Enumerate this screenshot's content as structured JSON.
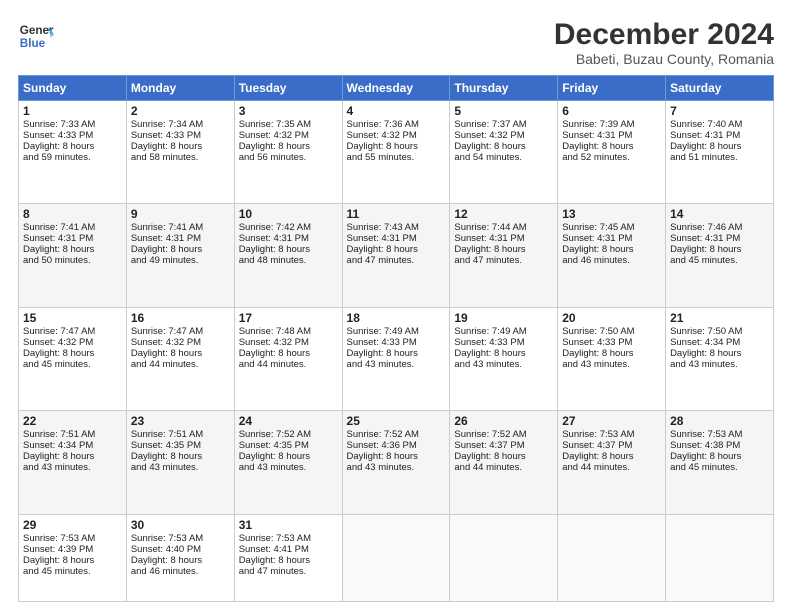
{
  "header": {
    "logo_line1": "General",
    "logo_line2": "Blue",
    "title": "December 2024",
    "subtitle": "Babeti, Buzau County, Romania"
  },
  "columns": [
    "Sunday",
    "Monday",
    "Tuesday",
    "Wednesday",
    "Thursday",
    "Friday",
    "Saturday"
  ],
  "weeks": [
    [
      {
        "day": "1",
        "lines": [
          "Sunrise: 7:33 AM",
          "Sunset: 4:33 PM",
          "Daylight: 8 hours",
          "and 59 minutes."
        ]
      },
      {
        "day": "2",
        "lines": [
          "Sunrise: 7:34 AM",
          "Sunset: 4:33 PM",
          "Daylight: 8 hours",
          "and 58 minutes."
        ]
      },
      {
        "day": "3",
        "lines": [
          "Sunrise: 7:35 AM",
          "Sunset: 4:32 PM",
          "Daylight: 8 hours",
          "and 56 minutes."
        ]
      },
      {
        "day": "4",
        "lines": [
          "Sunrise: 7:36 AM",
          "Sunset: 4:32 PM",
          "Daylight: 8 hours",
          "and 55 minutes."
        ]
      },
      {
        "day": "5",
        "lines": [
          "Sunrise: 7:37 AM",
          "Sunset: 4:32 PM",
          "Daylight: 8 hours",
          "and 54 minutes."
        ]
      },
      {
        "day": "6",
        "lines": [
          "Sunrise: 7:39 AM",
          "Sunset: 4:31 PM",
          "Daylight: 8 hours",
          "and 52 minutes."
        ]
      },
      {
        "day": "7",
        "lines": [
          "Sunrise: 7:40 AM",
          "Sunset: 4:31 PM",
          "Daylight: 8 hours",
          "and 51 minutes."
        ]
      }
    ],
    [
      {
        "day": "8",
        "lines": [
          "Sunrise: 7:41 AM",
          "Sunset: 4:31 PM",
          "Daylight: 8 hours",
          "and 50 minutes."
        ]
      },
      {
        "day": "9",
        "lines": [
          "Sunrise: 7:41 AM",
          "Sunset: 4:31 PM",
          "Daylight: 8 hours",
          "and 49 minutes."
        ]
      },
      {
        "day": "10",
        "lines": [
          "Sunrise: 7:42 AM",
          "Sunset: 4:31 PM",
          "Daylight: 8 hours",
          "and 48 minutes."
        ]
      },
      {
        "day": "11",
        "lines": [
          "Sunrise: 7:43 AM",
          "Sunset: 4:31 PM",
          "Daylight: 8 hours",
          "and 47 minutes."
        ]
      },
      {
        "day": "12",
        "lines": [
          "Sunrise: 7:44 AM",
          "Sunset: 4:31 PM",
          "Daylight: 8 hours",
          "and 47 minutes."
        ]
      },
      {
        "day": "13",
        "lines": [
          "Sunrise: 7:45 AM",
          "Sunset: 4:31 PM",
          "Daylight: 8 hours",
          "and 46 minutes."
        ]
      },
      {
        "day": "14",
        "lines": [
          "Sunrise: 7:46 AM",
          "Sunset: 4:31 PM",
          "Daylight: 8 hours",
          "and 45 minutes."
        ]
      }
    ],
    [
      {
        "day": "15",
        "lines": [
          "Sunrise: 7:47 AM",
          "Sunset: 4:32 PM",
          "Daylight: 8 hours",
          "and 45 minutes."
        ]
      },
      {
        "day": "16",
        "lines": [
          "Sunrise: 7:47 AM",
          "Sunset: 4:32 PM",
          "Daylight: 8 hours",
          "and 44 minutes."
        ]
      },
      {
        "day": "17",
        "lines": [
          "Sunrise: 7:48 AM",
          "Sunset: 4:32 PM",
          "Daylight: 8 hours",
          "and 44 minutes."
        ]
      },
      {
        "day": "18",
        "lines": [
          "Sunrise: 7:49 AM",
          "Sunset: 4:33 PM",
          "Daylight: 8 hours",
          "and 43 minutes."
        ]
      },
      {
        "day": "19",
        "lines": [
          "Sunrise: 7:49 AM",
          "Sunset: 4:33 PM",
          "Daylight: 8 hours",
          "and 43 minutes."
        ]
      },
      {
        "day": "20",
        "lines": [
          "Sunrise: 7:50 AM",
          "Sunset: 4:33 PM",
          "Daylight: 8 hours",
          "and 43 minutes."
        ]
      },
      {
        "day": "21",
        "lines": [
          "Sunrise: 7:50 AM",
          "Sunset: 4:34 PM",
          "Daylight: 8 hours",
          "and 43 minutes."
        ]
      }
    ],
    [
      {
        "day": "22",
        "lines": [
          "Sunrise: 7:51 AM",
          "Sunset: 4:34 PM",
          "Daylight: 8 hours",
          "and 43 minutes."
        ]
      },
      {
        "day": "23",
        "lines": [
          "Sunrise: 7:51 AM",
          "Sunset: 4:35 PM",
          "Daylight: 8 hours",
          "and 43 minutes."
        ]
      },
      {
        "day": "24",
        "lines": [
          "Sunrise: 7:52 AM",
          "Sunset: 4:35 PM",
          "Daylight: 8 hours",
          "and 43 minutes."
        ]
      },
      {
        "day": "25",
        "lines": [
          "Sunrise: 7:52 AM",
          "Sunset: 4:36 PM",
          "Daylight: 8 hours",
          "and 43 minutes."
        ]
      },
      {
        "day": "26",
        "lines": [
          "Sunrise: 7:52 AM",
          "Sunset: 4:37 PM",
          "Daylight: 8 hours",
          "and 44 minutes."
        ]
      },
      {
        "day": "27",
        "lines": [
          "Sunrise: 7:53 AM",
          "Sunset: 4:37 PM",
          "Daylight: 8 hours",
          "and 44 minutes."
        ]
      },
      {
        "day": "28",
        "lines": [
          "Sunrise: 7:53 AM",
          "Sunset: 4:38 PM",
          "Daylight: 8 hours",
          "and 45 minutes."
        ]
      }
    ],
    [
      {
        "day": "29",
        "lines": [
          "Sunrise: 7:53 AM",
          "Sunset: 4:39 PM",
          "Daylight: 8 hours",
          "and 45 minutes."
        ]
      },
      {
        "day": "30",
        "lines": [
          "Sunrise: 7:53 AM",
          "Sunset: 4:40 PM",
          "Daylight: 8 hours",
          "and 46 minutes."
        ]
      },
      {
        "day": "31",
        "lines": [
          "Sunrise: 7:53 AM",
          "Sunset: 4:41 PM",
          "Daylight: 8 hours",
          "and 47 minutes."
        ]
      },
      null,
      null,
      null,
      null
    ]
  ]
}
